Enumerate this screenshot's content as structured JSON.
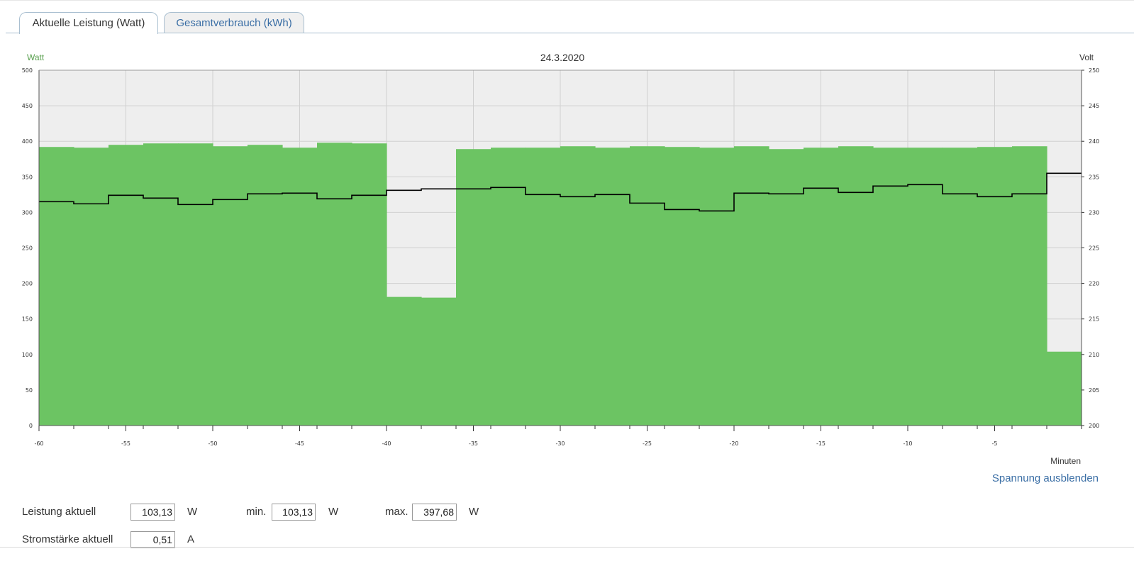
{
  "tabs": [
    {
      "label": "Aktuelle Leistung (Watt)",
      "active": true
    },
    {
      "label": "Gesamtverbrauch (kWh)",
      "active": false
    }
  ],
  "chart": {
    "title": "24.3.2020",
    "left_axis_title": "Watt",
    "right_axis_title": "Volt",
    "x_axis_title": "Minuten",
    "colors": {
      "area": "#6cc463",
      "plot_background": "#eeeeee",
      "line": "#000000",
      "grid": "#d0d0d0",
      "left_axis_title": "#5aa04f"
    }
  },
  "chart_data": {
    "type": "area",
    "x": [
      -60,
      -58,
      -56,
      -54,
      -52,
      -50,
      -48,
      -46,
      -44,
      -42,
      -40,
      -38,
      -36,
      -34,
      -32,
      -30,
      -28,
      -26,
      -24,
      -22,
      -20,
      -18,
      -16,
      -14,
      -12,
      -10,
      -8,
      -6,
      -4,
      -2
    ],
    "x_end": 0,
    "xlim": [
      -60,
      0
    ],
    "xticks": [
      -60,
      -55,
      -50,
      -45,
      -40,
      -35,
      -30,
      -25,
      -20,
      -15,
      -10,
      -5
    ],
    "ylim": [
      0,
      500
    ],
    "yticks": [
      0,
      50,
      100,
      150,
      200,
      250,
      300,
      350,
      400,
      450,
      500
    ],
    "y2lim": [
      200,
      250
    ],
    "y2ticks": [
      200,
      205,
      210,
      215,
      220,
      225,
      230,
      235,
      240,
      245,
      250
    ],
    "xlabel": "Minuten",
    "ylabel": "Watt",
    "y2label": "Volt",
    "grid": true,
    "step": true,
    "series": [
      {
        "axis": "left",
        "style": "area",
        "values": [
          392,
          391,
          395,
          397,
          397,
          393,
          395,
          391,
          398,
          397,
          181,
          180,
          389,
          391,
          391,
          393,
          391,
          393,
          392,
          391,
          393,
          389,
          391,
          393,
          391,
          391,
          391,
          392,
          393,
          104
        ]
      },
      {
        "axis": "right",
        "style": "line",
        "values": [
          231.5,
          231.2,
          232.4,
          232.0,
          231.1,
          231.8,
          232.6,
          232.7,
          231.9,
          232.4,
          233.1,
          233.3,
          233.3,
          233.5,
          232.5,
          232.2,
          232.5,
          231.3,
          230.4,
          230.2,
          232.7,
          232.6,
          233.4,
          232.8,
          233.7,
          233.9,
          232.6,
          232.2,
          232.6,
          235.5
        ]
      }
    ]
  },
  "link": {
    "label": "Spannung ausblenden"
  },
  "stats": {
    "power_label": "Leistung aktuell",
    "power_value": "103,13",
    "power_unit": "W",
    "min_label": "min.",
    "min_value": "103,13",
    "min_unit": "W",
    "max_label": "max.",
    "max_value": "397,68",
    "max_unit": "W",
    "current_label": "Stromstärke aktuell",
    "current_value": "0,51",
    "current_unit": "A"
  }
}
